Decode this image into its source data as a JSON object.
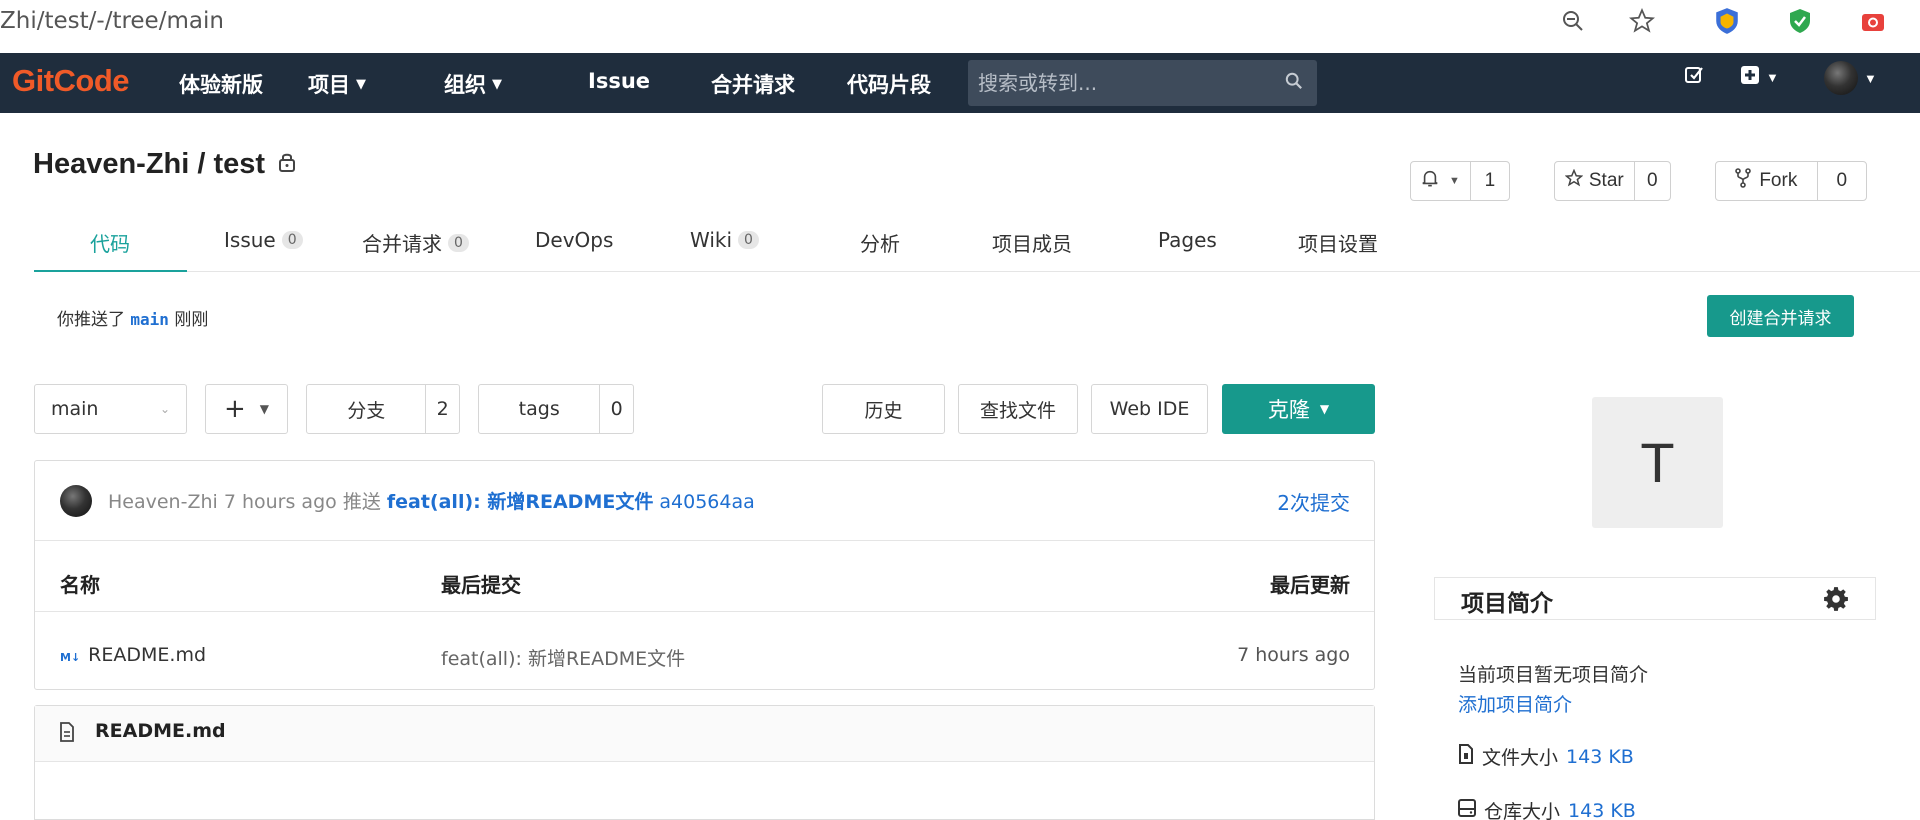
{
  "browser": {
    "url": "Zhi/test/-/tree/main"
  },
  "topnav": {
    "logo": "GitCode",
    "items": [
      {
        "label": "体验新版"
      },
      {
        "label": "项目"
      },
      {
        "label": "组织"
      },
      {
        "label": "Issue"
      },
      {
        "label": "合并请求"
      },
      {
        "label": "代码片段"
      }
    ],
    "search_placeholder": "搜索或转到..."
  },
  "project": {
    "title": "Heaven-Zhi / test",
    "watch_count": "1",
    "star_label": "Star",
    "star_count": "0",
    "fork_label": "Fork",
    "fork_count": "0"
  },
  "tabs": [
    {
      "label": "代码",
      "badge": ""
    },
    {
      "label": "Issue",
      "badge": "0"
    },
    {
      "label": "合并请求",
      "badge": "0"
    },
    {
      "label": "DevOps",
      "badge": ""
    },
    {
      "label": "Wiki",
      "badge": "0"
    },
    {
      "label": "分析",
      "badge": ""
    },
    {
      "label": "项目成员",
      "badge": ""
    },
    {
      "label": "Pages",
      "badge": ""
    },
    {
      "label": "项目设置",
      "badge": ""
    }
  ],
  "push_notice": {
    "prefix": "你推送了",
    "branch": "main",
    "suffix": "刚刚"
  },
  "create_mr_label": "创建合并请求",
  "toolbar": {
    "branch": "main",
    "add": "+",
    "branches_label": "分支",
    "branches_count": "2",
    "tags_label": "tags",
    "tags_count": "0",
    "history": "历史",
    "find_file": "查找文件",
    "web_ide": "Web IDE",
    "clone": "克隆"
  },
  "last_commit": {
    "author": "Heaven-Zhi",
    "time": "7 hours ago",
    "action": "推送",
    "message": "feat(all): 新增README文件",
    "sha": "a40564aa",
    "count": "2次提交"
  },
  "file_table": {
    "headers": [
      "名称",
      "最后提交",
      "最后更新"
    ],
    "rows": [
      {
        "name": "README.md",
        "commit": "feat(all): 新增README文件",
        "updated": "7 hours ago"
      }
    ]
  },
  "readme": {
    "title": "README.md"
  },
  "sidebar": {
    "avatar_letter": "T",
    "section_title": "项目简介",
    "no_description": "当前项目暂无项目简介",
    "add_description": "添加项目简介",
    "file_size_label": "文件大小",
    "file_size": "143 KB",
    "repo_size_label": "仓库大小",
    "repo_size": "143 KB"
  }
}
